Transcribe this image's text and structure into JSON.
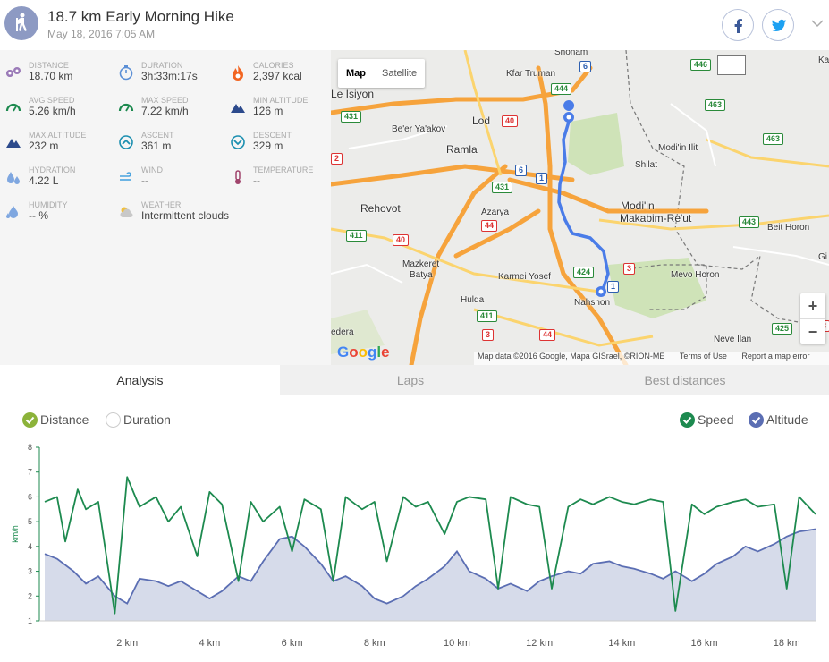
{
  "header": {
    "title": "18.7 km Early Morning Hike",
    "date": "May 18, 2016 7:05 AM",
    "share": [
      "facebook-icon",
      "twitter-icon"
    ]
  },
  "stats": [
    {
      "label": "DISTANCE",
      "value": "18.70 km",
      "icon": "distance-icon",
      "color": "#9b7bb8"
    },
    {
      "label": "DURATION",
      "value": "3h:33m:17s",
      "icon": "stopwatch-icon",
      "color": "#5b8fd6"
    },
    {
      "label": "CALORIES",
      "value": "2,397 kcal",
      "icon": "flame-icon",
      "color": "#f26522"
    },
    {
      "label": "AVG SPEED",
      "value": "5.26 km/h",
      "icon": "speedometer-icon",
      "color": "#1d8a4f"
    },
    {
      "label": "MAX SPEED",
      "value": "7.22 km/h",
      "icon": "speedometer-icon",
      "color": "#1d8a4f"
    },
    {
      "label": "MIN ALTITUDE",
      "value": "126 m",
      "icon": "mountain-icon",
      "color": "#2c4a8c"
    },
    {
      "label": "MAX ALTITUDE",
      "value": "232 m",
      "icon": "mountain-icon",
      "color": "#2c4a8c"
    },
    {
      "label": "ASCENT",
      "value": "361 m",
      "icon": "ascent-icon",
      "color": "#1b8fb0"
    },
    {
      "label": "DESCENT",
      "value": "329 m",
      "icon": "descent-icon",
      "color": "#1b8fb0"
    },
    {
      "label": "HYDRATION",
      "value": "4.22 L",
      "icon": "water-drops-icon",
      "color": "#7fa7e0"
    },
    {
      "label": "WIND",
      "value": "--",
      "icon": "wind-icon",
      "color": "#4aa3df"
    },
    {
      "label": "TEMPERATURE",
      "value": "--",
      "icon": "thermometer-icon",
      "color": "#a0446c"
    },
    {
      "label": "HUMIDITY",
      "value": "-- %",
      "icon": "humidity-icon",
      "color": "#7fa7e0"
    },
    {
      "label": "WEATHER",
      "value": "Intermittent clouds",
      "icon": "cloud-sun-icon",
      "color": "#c8c8c8"
    }
  ],
  "map": {
    "map_label": "Map",
    "satellite_label": "Satellite",
    "zoom_in": "+",
    "zoom_out": "−",
    "logo": "Google",
    "attribution": "Map data ©2016 Google, Mapa GISrael, ©RION-ME",
    "terms": "Terms of Use",
    "report": "Report a map error",
    "places": [
      {
        "name": "Le Isiyon"
      },
      {
        "name": "Lod"
      },
      {
        "name": "Kfar Truman"
      },
      {
        "name": "Be'er Ya'akov"
      },
      {
        "name": "Ramla"
      },
      {
        "name": "Modi'in Ilit"
      },
      {
        "name": "Shilat"
      },
      {
        "name": "Modi'in"
      },
      {
        "name": "Makabim-Re'ut"
      },
      {
        "name": "Rehovot"
      },
      {
        "name": "Azarya"
      },
      {
        "name": "Beit Horon"
      },
      {
        "name": "Mazkeret"
      },
      {
        "name": "Batya"
      },
      {
        "name": "Karmei Yosef"
      },
      {
        "name": "Mevo Horon"
      },
      {
        "name": "Hulda"
      },
      {
        "name": "Nahshon"
      },
      {
        "name": "edera"
      },
      {
        "name": "Neve Ilan"
      },
      {
        "name": "Kai"
      },
      {
        "name": "Gi"
      },
      {
        "name": "Shoham"
      }
    ],
    "road_labels": [
      "6",
      "444",
      "446",
      "431",
      "40",
      "463",
      "6",
      "431",
      "1",
      "463",
      "443",
      "411",
      "40",
      "44",
      "424",
      "3",
      "1",
      "411",
      "3",
      "44",
      "425",
      "2",
      "3"
    ]
  },
  "tabs": [
    {
      "label": "Analysis",
      "active": true
    },
    {
      "label": "Laps",
      "active": false
    },
    {
      "label": "Best distances",
      "active": false
    }
  ],
  "chart_toggles": {
    "distance": {
      "label": "Distance",
      "checked": true,
      "color": "#8cb33a"
    },
    "duration": {
      "label": "Duration",
      "checked": false
    },
    "speed": {
      "label": "Speed",
      "checked": true,
      "color": "#1d8a4f"
    },
    "altitude": {
      "label": "Altitude",
      "checked": true,
      "color": "#5b6eb3"
    }
  },
  "chart_data": {
    "type": "line",
    "ylabel": "km/h",
    "yticks": [
      1,
      2,
      3,
      4,
      5,
      6,
      7,
      8
    ],
    "ylim": [
      1,
      8
    ],
    "xticks": [
      "2 km",
      "4 km",
      "6 km",
      "8 km",
      "10 km",
      "12 km",
      "14 km",
      "16 km",
      "18 km"
    ],
    "xlim": [
      0,
      18.7
    ],
    "series": [
      {
        "name": "Speed",
        "color": "#1d8a4f",
        "x": [
          0,
          0.3,
          0.5,
          0.8,
          1.0,
          1.3,
          1.7,
          2.0,
          2.3,
          2.7,
          3.0,
          3.3,
          3.7,
          4.0,
          4.3,
          4.7,
          5.0,
          5.3,
          5.7,
          6.0,
          6.3,
          6.7,
          7.0,
          7.3,
          7.7,
          8.0,
          8.3,
          8.7,
          9.0,
          9.3,
          9.7,
          10.0,
          10.3,
          10.7,
          11.0,
          11.3,
          11.7,
          12.0,
          12.3,
          12.7,
          13.0,
          13.3,
          13.7,
          14.0,
          14.3,
          14.7,
          15.0,
          15.3,
          15.7,
          16.0,
          16.3,
          16.7,
          17.0,
          17.3,
          17.7,
          18.0,
          18.3,
          18.7
        ],
        "y": [
          5.8,
          6.0,
          4.2,
          6.3,
          5.5,
          5.8,
          1.3,
          6.8,
          5.6,
          6.0,
          5.0,
          5.6,
          3.6,
          6.2,
          5.7,
          2.6,
          5.8,
          5.0,
          5.6,
          3.8,
          5.9,
          5.5,
          2.6,
          6.0,
          5.5,
          5.8,
          3.4,
          6.0,
          5.6,
          5.8,
          4.5,
          5.8,
          6.0,
          5.9,
          2.3,
          6.0,
          5.7,
          5.6,
          2.3,
          5.6,
          5.9,
          5.7,
          6.0,
          5.8,
          5.7,
          5.9,
          5.8,
          1.4,
          5.7,
          5.3,
          5.6,
          5.8,
          5.9,
          5.6,
          5.7,
          2.3,
          6.0,
          5.3
        ]
      },
      {
        "name": "Altitude",
        "color": "#5b6eb3",
        "x": [
          0,
          0.3,
          0.7,
          1.0,
          1.3,
          1.7,
          2.0,
          2.3,
          2.7,
          3.0,
          3.3,
          3.7,
          4.0,
          4.3,
          4.7,
          5.0,
          5.3,
          5.7,
          6.0,
          6.3,
          6.7,
          7.0,
          7.3,
          7.7,
          8.0,
          8.3,
          8.7,
          9.0,
          9.3,
          9.7,
          10.0,
          10.3,
          10.7,
          11.0,
          11.3,
          11.7,
          12.0,
          12.3,
          12.7,
          13.0,
          13.3,
          13.7,
          14.0,
          14.3,
          14.7,
          15.0,
          15.3,
          15.7,
          16.0,
          16.3,
          16.7,
          17.0,
          17.3,
          17.7,
          18.0,
          18.3,
          18.7
        ],
        "y": [
          3.7,
          3.5,
          3.0,
          2.5,
          2.8,
          2.0,
          1.7,
          2.7,
          2.6,
          2.4,
          2.6,
          2.2,
          1.9,
          2.2,
          2.8,
          2.6,
          3.4,
          4.3,
          4.4,
          4.0,
          3.3,
          2.6,
          2.8,
          2.4,
          1.9,
          1.7,
          2.0,
          2.4,
          2.7,
          3.2,
          3.8,
          3.0,
          2.7,
          2.3,
          2.5,
          2.2,
          2.6,
          2.8,
          3.0,
          2.9,
          3.3,
          3.4,
          3.2,
          3.1,
          2.9,
          2.7,
          3.0,
          2.6,
          2.9,
          3.3,
          3.6,
          4.0,
          3.8,
          4.1,
          4.4,
          4.6,
          4.7
        ]
      }
    ]
  }
}
